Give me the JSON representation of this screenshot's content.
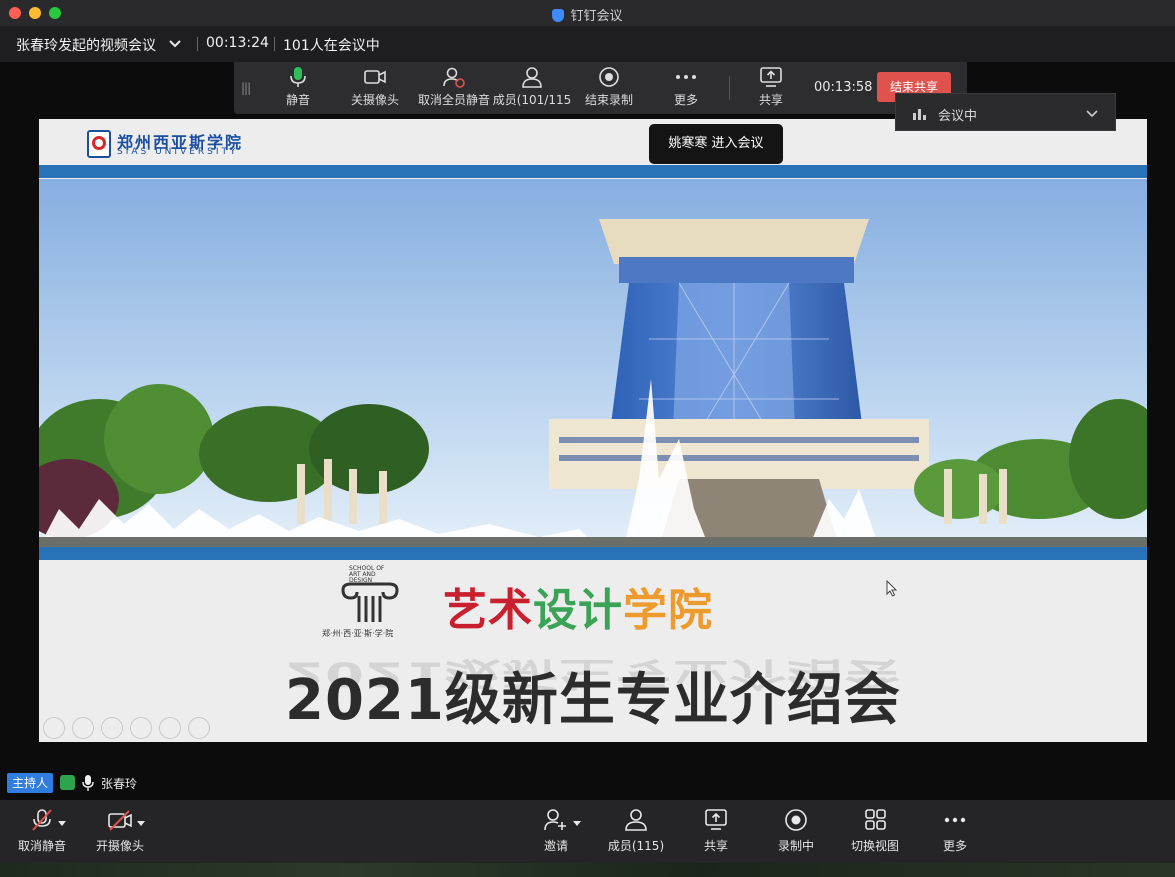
{
  "window": {
    "title": "钉钉会议"
  },
  "meeting": {
    "topic": "张春玲发起的视频会议",
    "elapsed": "00:13:24",
    "participants_text": "101人在会议中"
  },
  "share_toolbar": {
    "mute": "静音",
    "camera_off": "关摄像头",
    "unmute_all": "取消全员静音",
    "members": "成员(101/115",
    "stop_record": "结束录制",
    "more": "更多",
    "share": "共享",
    "timer": "00:13:58",
    "end_share": "结束共享"
  },
  "status_dropdown": {
    "label": "会议中"
  },
  "toast": {
    "text": "姚寒寒 进入会议"
  },
  "slide": {
    "logo_cn": "郑州西亚斯学院",
    "logo_en": "SIAS UNIVERSITY",
    "logo_seal": "SIAS",
    "emblem_top": "SCHOOL OF ART AND DESIGN",
    "emblem_bottom": "郑·州·西·亚·斯·学·院",
    "college_part1": "艺术",
    "college_part2": "设计",
    "college_part3": "学院",
    "headline": "2021级新生专业介绍会"
  },
  "speaker": {
    "role": "主持人",
    "name": "张春玲"
  },
  "bottom_toolbar": {
    "unmute": "取消静音",
    "camera_on": "开摄像头",
    "invite": "邀请",
    "members": "成员(115)",
    "share": "共享",
    "recording": "录制中",
    "switch_view": "切换视图",
    "more": "更多"
  },
  "colors": {
    "end_share": "#e0524d",
    "host_badge": "#2f7de1",
    "slide_band": "#2a72b8",
    "college_red": "#c8202f",
    "college_green": "#3aa356",
    "college_orange": "#ee9b2e"
  }
}
